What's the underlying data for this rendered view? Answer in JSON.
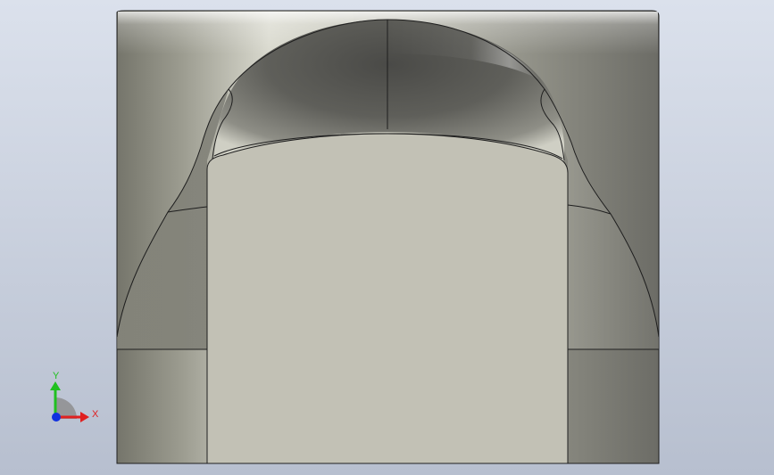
{
  "viewport": {
    "background_top": "#dbe1ec",
    "background_bottom": "#b7bfcf",
    "model_edge_color": "#1e1e1e",
    "face_color": "#c2c1b5"
  },
  "triad": {
    "x_label": "X",
    "y_label": "Y",
    "x_color": "#e02020",
    "y_color": "#20c020",
    "z_color": "#1030e0"
  }
}
